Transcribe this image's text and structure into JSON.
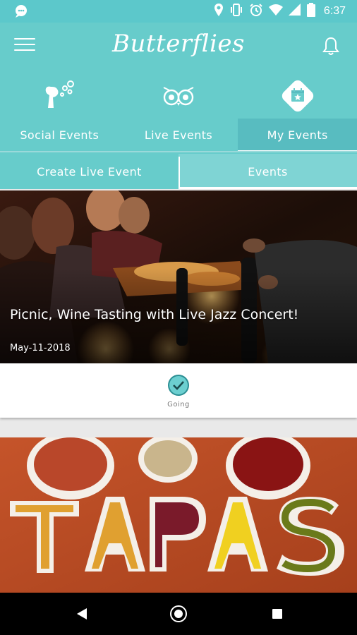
{
  "status_bar": {
    "time": "6:37",
    "icons": [
      "chat-bubble-icon",
      "location-icon",
      "vibrate-icon",
      "alarm-icon",
      "wifi-icon",
      "signal-icon",
      "battery-icon"
    ]
  },
  "header": {
    "app_title": "Butterflies",
    "menu_icon": "hamburger-menu-icon",
    "bell_icon": "bell-icon"
  },
  "top_tabs": [
    {
      "label": "Social Events",
      "icon": "social-events-icon",
      "active": false
    },
    {
      "label": "Live Events",
      "icon": "owl-icon",
      "active": false
    },
    {
      "label": "My Events",
      "icon": "calendar-star-icon",
      "active": true
    }
  ],
  "sub_tabs": [
    {
      "label": "Create Live Event",
      "active": false
    },
    {
      "label": "Events",
      "active": true
    }
  ],
  "events": [
    {
      "title": "Picnic, Wine Tasting with Live Jazz Concert!",
      "date": "May-11-2018",
      "status_label": "Going"
    },
    {
      "image_text": "TAPAS"
    }
  ],
  "colors": {
    "primary": "#67cccb",
    "primary_dark": "#58bcc0",
    "going_check": "#2c8f94"
  },
  "system_nav": [
    "back-icon",
    "home-icon",
    "recents-icon"
  ]
}
